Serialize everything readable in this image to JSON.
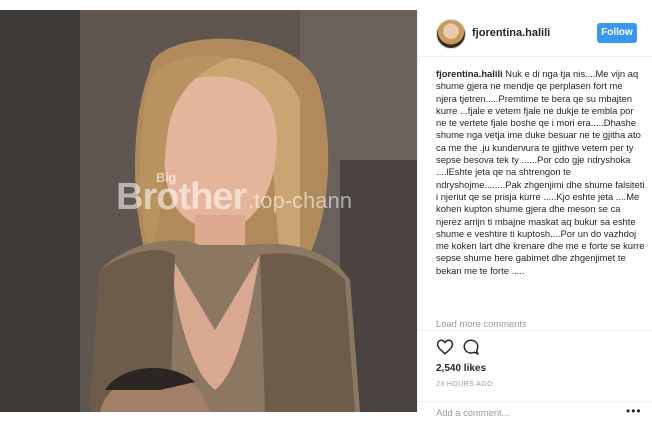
{
  "photo": {
    "watermark_big": "Big",
    "watermark_main": "Brother",
    "watermark_site": ".top-chann"
  },
  "header": {
    "username": "fjorentina.halili",
    "follow_label": "Follow"
  },
  "caption": {
    "username": "fjorentina.halili",
    "text": "Nuk e di nga tja nis....Me vijn aq shume gjera ne mendje qe perplasen fort me njera tjetren.....Premtime te bera qe su mbajten kurre ...fjale e vetem fjale ne dukje te embla por ne te vertete fjale boshe qe i mori era.....Dhashe shume nga vetja ime duke besuar ne te gjitha ato ca me the .ju kundervura te gjithve vetem per ty sepse besova tek ty ......Por cdo gje ndryshoka ....lEshte jeta qe na shtrengon te ndryshojme........Pak zhgenjimi dhe shume falsiteti i njeriut qe se prisja kurre .....Kjo eshte jeta ....Me kohen kupton shume gjera dhe meson se ca njerez arrijn ti mbajne maskat aq bukur sa eshte shume e veshtire ti kuptosh....Por un do vazhdoj me koken lart dhe krenare dhe me e forte se kurre sepse shume here gabimet dhe zhgenjimet te bekan me te forte ....."
  },
  "load_more": "Load more comments",
  "actions": {
    "icons": [
      "heart-icon",
      "comment-icon"
    ],
    "likes": "2,540 likes",
    "timestamp": "23 HOURS AGO"
  },
  "comment": {
    "placeholder": "Add a comment...",
    "more": "•••"
  }
}
